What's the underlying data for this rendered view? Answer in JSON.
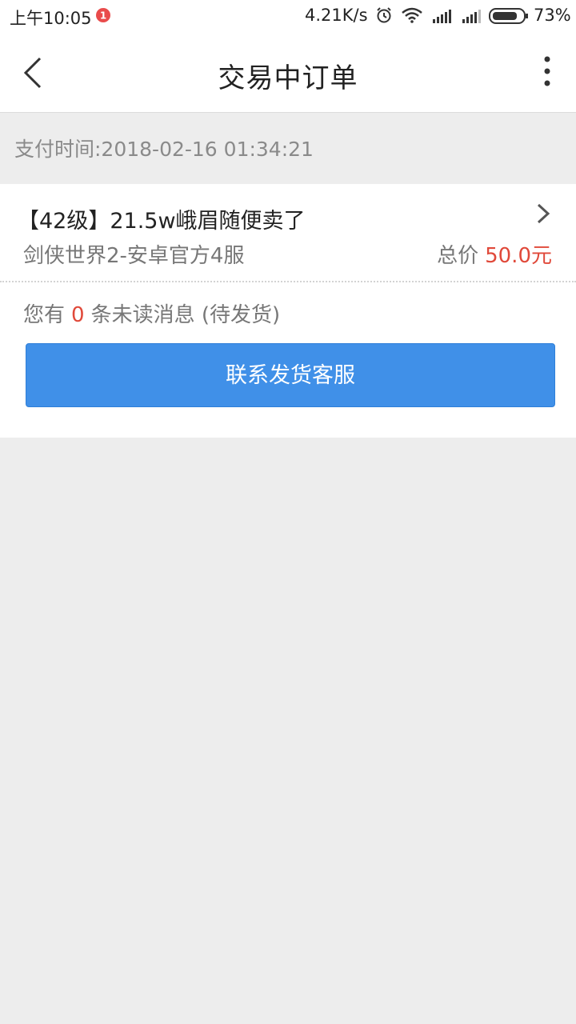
{
  "status_bar": {
    "time": "上午10:05",
    "network_speed": "4.21K/s",
    "battery": "73%",
    "icons": [
      "notification-badge-icon",
      "alarm-icon",
      "wifi-icon",
      "signal-icon",
      "signal-icon",
      "battery-icon"
    ]
  },
  "nav": {
    "title": "交易中订单",
    "back_icon": "back-chevron-icon",
    "more_icon": "more-vertical-icon"
  },
  "order": {
    "pay_time": "支付时间:2018-02-16 01:34:21",
    "title": "【42级】21.5w峨眉随便卖了",
    "server": "剑侠世界2-安卓官方4服",
    "price_label": "总价",
    "price_value": "50.0元",
    "messages_prefix": "您有",
    "unread_count": "0",
    "messages_suffix": "条未读消息 (待发货)",
    "contact_button": "联系发货客服"
  },
  "colors": {
    "accent_button": "#4090e8",
    "price_red": "#e0493a",
    "background": "#ededed"
  }
}
